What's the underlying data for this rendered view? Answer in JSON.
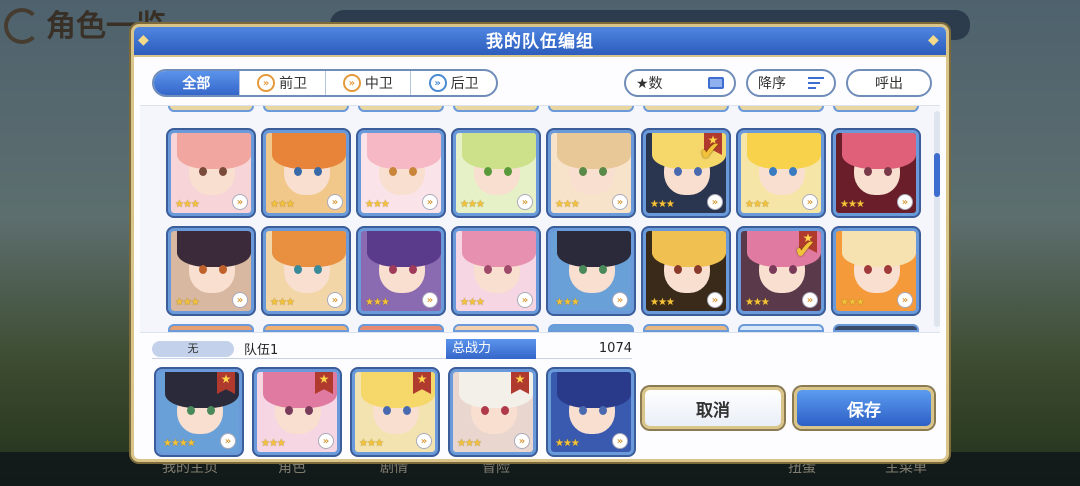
{
  "background": {
    "title": "角色一览",
    "nav": [
      "我的主页",
      "角色",
      "剧情",
      "冒险",
      "扭蛋",
      "主菜单"
    ]
  },
  "dialog": {
    "title": "我的队伍编组",
    "filter_tabs": [
      {
        "label": "全部",
        "icon": ""
      },
      {
        "label": "前卫",
        "icon": "vanguard-icon"
      },
      {
        "label": "中卫",
        "icon": "midguard-icon"
      },
      {
        "label": "后卫",
        "icon": "rearguard-icon"
      }
    ],
    "sort_field": "★数",
    "sort_order": "降序",
    "call_label": "呼出",
    "team": {
      "none_label": "无",
      "name": "队伍1",
      "power_label": "总战力",
      "power_value": "1074"
    },
    "cancel_label": "取消",
    "save_label": "保存"
  },
  "grid_rows": [
    [
      {
        "stars": 3,
        "hair": "#f2a6a0",
        "eye": "#7a4a3a",
        "bg": "#f6d4d8",
        "selected": false
      },
      {
        "stars": 3,
        "hair": "#e8843a",
        "eye": "#3a6aa8",
        "bg": "#f1c88a",
        "selected": false
      },
      {
        "stars": 3,
        "hair": "#f5b8c4",
        "eye": "#c9853a",
        "bg": "#fbe3ea",
        "selected": false
      },
      {
        "stars": 3,
        "hair": "#cde08a",
        "eye": "#5a9a3a",
        "bg": "#e6f1c8",
        "selected": false
      },
      {
        "stars": 3,
        "hair": "#e9c898",
        "eye": "#5a8a4a",
        "bg": "#f7e3c9",
        "selected": false
      },
      {
        "stars": 3,
        "hair": "#f5d76a",
        "eye": "#4a6ab0",
        "bg": "#2a3550",
        "selected": true
      },
      {
        "stars": 3,
        "hair": "#f7d24a",
        "eye": "#3a7ac0",
        "bg": "#f5e6a8",
        "selected": false
      },
      {
        "stars": 3,
        "hair": "#e0607a",
        "eye": "#7a3a4a",
        "bg": "#6a1e2a",
        "selected": false
      }
    ],
    [
      {
        "stars": 3,
        "hair": "#3a2a3a",
        "eye": "#c0602a",
        "bg": "#d8b8a0",
        "selected": false
      },
      {
        "stars": 3,
        "hair": "#e89040",
        "eye": "#3a8a9a",
        "bg": "#f3d6a8",
        "selected": false
      },
      {
        "stars": 3,
        "hair": "#5a3a8a",
        "eye": "#a03a5a",
        "bg": "#8a6ab0",
        "selected": false
      },
      {
        "stars": 3,
        "hair": "#e890b0",
        "eye": "#a04a6a",
        "bg": "#f5d6e2",
        "selected": false
      },
      {
        "stars": 3,
        "hair": "#2a2a3a",
        "eye": "#4a8a5a",
        "bg": "#6aa0d8",
        "selected": false
      },
      {
        "stars": 3,
        "hair": "#f0c050",
        "eye": "#8a3a2a",
        "bg": "#3a2a1a",
        "selected": false
      },
      {
        "stars": 3,
        "hair": "#e07aa0",
        "eye": "#7a3a5a",
        "bg": "#5a3a4a",
        "selected": true
      },
      {
        "stars": 3,
        "hair": "#f6e2b0",
        "eye": "#a03a3a",
        "bg": "#f59a3a",
        "selected": false
      }
    ]
  ],
  "team_members": [
    {
      "stars": 4,
      "hair": "#2a2a3a",
      "eye": "#4a8a5a",
      "bg": "#6aa0d8"
    },
    {
      "stars": 3,
      "hair": "#e07aa0",
      "eye": "#7a3a5a",
      "bg": "#f5d6e2"
    },
    {
      "stars": 3,
      "hair": "#f5d76a",
      "eye": "#4a6ab0",
      "bg": "#f3e3b0"
    },
    {
      "stars": 3,
      "hair": "#f3f0ea",
      "eye": "#b03a4a",
      "bg": "#e8d6cf"
    },
    {
      "stars": 3,
      "hair": "#2a3a8a",
      "eye": "#4a6ab0",
      "bg": "#3a5ab0"
    }
  ]
}
